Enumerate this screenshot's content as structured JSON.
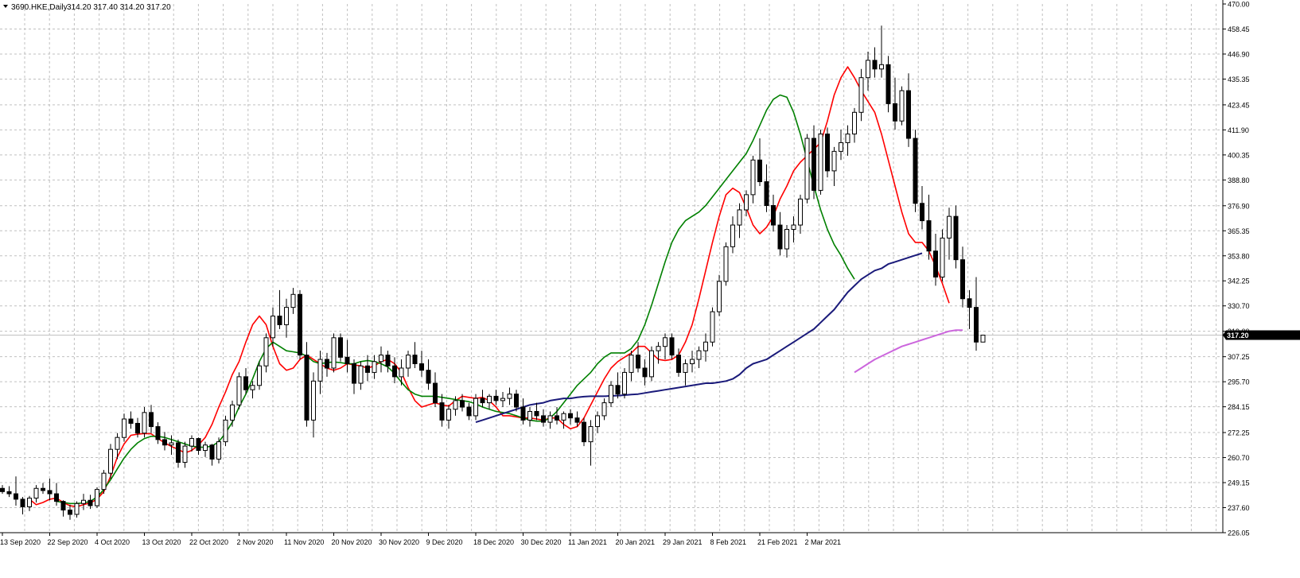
{
  "header": {
    "symbol": "3690.HKE,Daily",
    "ohlc": "314.20 317.40 314.20 317.20"
  },
  "colors": {
    "background": "#ffffff",
    "grid": "#c0c0c0",
    "axis": "#000000",
    "bull_fill": "#ffffff",
    "bear_fill": "#000000",
    "candle_outline": "#000000",
    "price_line": "#c0c0c0",
    "price_label_bg": "#000000",
    "price_label_text": "#ffffff"
  },
  "chart_data": {
    "type": "candlestick",
    "title": "3690.HKE,Daily",
    "ylim": [
      226.05,
      470.0
    ],
    "y_ticks": [
      "470.00",
      "458.45",
      "446.90",
      "435.35",
      "423.45",
      "411.90",
      "400.35",
      "388.80",
      "376.90",
      "365.35",
      "353.80",
      "342.25",
      "330.70",
      "319.00",
      "307.25",
      "295.70",
      "284.15",
      "272.25",
      "260.70",
      "249.15",
      "237.60",
      "226.05"
    ],
    "x_labels": [
      {
        "label": "13 Sep 2020",
        "index": 0
      },
      {
        "label": "22 Sep 2020",
        "index": 7
      },
      {
        "label": "4 Oct 2020",
        "index": 14
      },
      {
        "label": "13 Oct 2020",
        "index": 21
      },
      {
        "label": "22 Oct 2020",
        "index": 28
      },
      {
        "label": "2 Nov 2020",
        "index": 35
      },
      {
        "label": "11 Nov 2020",
        "index": 42
      },
      {
        "label": "20 Nov 2020",
        "index": 49
      },
      {
        "label": "30 Nov 2020",
        "index": 56
      },
      {
        "label": "9 Dec 2020",
        "index": 63
      },
      {
        "label": "18 Dec 2020",
        "index": 70
      },
      {
        "label": "30 Dec 2020",
        "index": 77
      },
      {
        "label": "11 Jan 2021",
        "index": 84
      },
      {
        "label": "20 Jan 2021",
        "index": 91
      },
      {
        "label": "29 Jan 2021",
        "index": 98
      },
      {
        "label": "8 Feb 2021",
        "index": 105
      },
      {
        "label": "21 Feb 2021",
        "index": 112
      },
      {
        "label": "2 Mar 2021",
        "index": 119
      }
    ],
    "candles": [
      [
        246.5,
        248.0,
        244.0,
        245.0
      ],
      [
        245.0,
        247.5,
        242.5,
        244.0
      ],
      [
        244.0,
        252.0,
        238.5,
        241.5
      ],
      [
        241.5,
        242.5,
        234.5,
        238.0
      ],
      [
        238.0,
        243.0,
        236.0,
        242.0
      ],
      [
        242.0,
        248.0,
        240.0,
        246.5
      ],
      [
        246.5,
        249.0,
        244.0,
        245.5
      ],
      [
        245.5,
        251.0,
        241.0,
        244.0
      ],
      [
        244.0,
        249.0,
        238.5,
        240.5
      ],
      [
        240.5,
        241.0,
        233.5,
        236.5
      ],
      [
        236.5,
        239.0,
        232.0,
        234.5
      ],
      [
        234.5,
        240.5,
        233.0,
        239.5
      ],
      [
        239.5,
        244.0,
        236.5,
        241.0
      ],
      [
        241.0,
        243.5,
        237.0,
        238.5
      ],
      [
        238.5,
        247.0,
        237.5,
        246.0
      ],
      [
        246.0,
        255.0,
        244.0,
        253.5
      ],
      [
        253.5,
        267.0,
        251.0,
        264.5
      ],
      [
        264.5,
        272.0,
        260.0,
        270.0
      ],
      [
        270.0,
        281.0,
        268.0,
        278.5
      ],
      [
        278.5,
        282.0,
        274.0,
        276.5
      ],
      [
        276.5,
        279.0,
        270.0,
        272.0
      ],
      [
        272.0,
        284.0,
        270.0,
        281.5
      ],
      [
        281.5,
        285.0,
        272.0,
        275.0
      ],
      [
        275.0,
        277.0,
        267.0,
        269.0
      ],
      [
        269.0,
        272.5,
        264.0,
        266.5
      ],
      [
        266.5,
        271.0,
        262.0,
        267.5
      ],
      [
        267.5,
        269.0,
        256.0,
        258.5
      ],
      [
        258.5,
        268.0,
        256.0,
        266.0
      ],
      [
        266.0,
        271.0,
        263.5,
        269.5
      ],
      [
        269.5,
        270.0,
        262.0,
        264.0
      ],
      [
        264.0,
        268.0,
        261.0,
        266.5
      ],
      [
        266.5,
        267.0,
        257.0,
        260.0
      ],
      [
        260.0,
        270.0,
        258.0,
        268.0
      ],
      [
        268.0,
        280.0,
        266.0,
        278.0
      ],
      [
        278.0,
        287.0,
        275.0,
        285.0
      ],
      [
        285.0,
        300.0,
        283.0,
        298.0
      ],
      [
        298.0,
        302.0,
        290.0,
        292.0
      ],
      [
        292.0,
        296.0,
        288.0,
        294.0
      ],
      [
        294.0,
        305.0,
        292.0,
        303.0
      ],
      [
        303.0,
        318.0,
        300.0,
        316.0
      ],
      [
        316.0,
        330.0,
        312.0,
        326.0
      ],
      [
        326.0,
        338.0,
        320.0,
        322.0
      ],
      [
        322.0,
        334.0,
        316.0,
        330.0
      ],
      [
        330.0,
        339.0,
        327.0,
        336.0
      ],
      [
        336.0,
        338.0,
        306.0,
        308.0
      ],
      [
        308.0,
        314.0,
        275.0,
        278.0
      ],
      [
        278.0,
        300.0,
        270.0,
        296.0
      ],
      [
        296.0,
        310.0,
        290.0,
        306.0
      ],
      [
        306.0,
        309.0,
        298.0,
        302.0
      ],
      [
        302.0,
        318.0,
        300.0,
        316.0
      ],
      [
        316.0,
        318.0,
        305.0,
        307.0
      ],
      [
        307.0,
        315.0,
        300.0,
        304.0
      ],
      [
        304.0,
        306.0,
        290.0,
        295.0
      ],
      [
        295.0,
        305.0,
        292.0,
        303.0
      ],
      [
        303.0,
        308.0,
        296.0,
        300.0
      ],
      [
        300.0,
        308.0,
        297.0,
        305.0
      ],
      [
        305.0,
        312.0,
        300.0,
        308.0
      ],
      [
        308.0,
        310.0,
        300.0,
        303.0
      ],
      [
        303.0,
        307.0,
        295.0,
        298.0
      ],
      [
        298.0,
        306.0,
        294.0,
        302.0
      ],
      [
        302.0,
        310.0,
        298.0,
        308.0
      ],
      [
        308.0,
        314.0,
        302.0,
        304.0
      ],
      [
        304.0,
        310.0,
        298.0,
        301.0
      ],
      [
        301.0,
        306.0,
        292.0,
        295.0
      ],
      [
        295.0,
        300.0,
        284.0,
        286.0
      ],
      [
        286.0,
        290.0,
        275.0,
        278.0
      ],
      [
        278.0,
        285.0,
        274.0,
        283.0
      ],
      [
        283.0,
        289.0,
        280.0,
        287.0
      ],
      [
        287.0,
        290.0,
        282.0,
        284.0
      ],
      [
        284.0,
        286.0,
        278.0,
        280.0
      ],
      [
        280.0,
        290.0,
        278.0,
        288.0
      ],
      [
        288.0,
        292.0,
        284.0,
        286.0
      ],
      [
        286.0,
        290.0,
        283.0,
        289.0
      ],
      [
        289.0,
        292.0,
        285.0,
        287.0
      ],
      [
        287.0,
        291.0,
        284.0,
        288.0
      ],
      [
        288.0,
        293.0,
        285.0,
        290.0
      ],
      [
        290.0,
        292.0,
        282.0,
        284.0
      ],
      [
        284.0,
        288.0,
        276.0,
        278.0
      ],
      [
        278.0,
        284.0,
        275.0,
        282.0
      ],
      [
        282.0,
        286.0,
        278.0,
        280.0
      ],
      [
        280.0,
        283.0,
        275.0,
        277.0
      ],
      [
        277.0,
        282.0,
        274.0,
        280.0
      ],
      [
        280.0,
        284.0,
        276.0,
        278.0
      ],
      [
        278.0,
        282.0,
        274.0,
        281.0
      ],
      [
        281.0,
        283.0,
        276.0,
        279.0
      ],
      [
        279.0,
        282.0,
        275.0,
        277.0
      ],
      [
        277.0,
        279.0,
        266.0,
        268.0
      ],
      [
        268.0,
        278.0,
        257.0,
        275.0
      ],
      [
        275.0,
        282.0,
        272.0,
        280.0
      ],
      [
        280.0,
        288.0,
        278.0,
        286.0
      ],
      [
        286.0,
        296.0,
        284.0,
        294.0
      ],
      [
        294.0,
        300.0,
        288.0,
        290.0
      ],
      [
        290.0,
        302.0,
        288.0,
        300.0
      ],
      [
        300.0,
        310.0,
        296.0,
        308.0
      ],
      [
        308.0,
        314.0,
        300.0,
        302.0
      ],
      [
        302.0,
        306.0,
        294.0,
        298.0
      ],
      [
        298.0,
        312.0,
        296.0,
        310.0
      ],
      [
        310.0,
        314.0,
        304.0,
        312.0
      ],
      [
        312.0,
        318.0,
        306.0,
        316.0
      ],
      [
        316.0,
        318.0,
        306.0,
        308.0
      ],
      [
        308.0,
        311.0,
        298.0,
        300.0
      ],
      [
        300.0,
        306.0,
        294.0,
        304.0
      ],
      [
        304.0,
        310.0,
        300.0,
        306.0
      ],
      [
        306.0,
        312.0,
        302.0,
        310.0
      ],
      [
        310.0,
        318.0,
        305.0,
        314.0
      ],
      [
        314.0,
        330.0,
        312.0,
        328.0
      ],
      [
        328.0,
        345.0,
        326.0,
        342.0
      ],
      [
        342.0,
        360.0,
        340.0,
        358.0
      ],
      [
        358.0,
        372.0,
        355.0,
        368.0
      ],
      [
        368.0,
        378.0,
        362.0,
        375.0
      ],
      [
        375.0,
        384.0,
        372.0,
        382.0
      ],
      [
        382.0,
        400.0,
        378.0,
        398.0
      ],
      [
        398.0,
        408.0,
        386.0,
        388.0
      ],
      [
        388.0,
        396.0,
        374.0,
        377.0
      ],
      [
        377.0,
        382.0,
        365.0,
        368.0
      ],
      [
        368.0,
        374.0,
        354.0,
        357.0
      ],
      [
        357.0,
        368.0,
        353.0,
        366.0
      ],
      [
        366.0,
        372.0,
        360.0,
        368.0
      ],
      [
        368.0,
        382.0,
        364.0,
        380.0
      ],
      [
        380.0,
        410.0,
        378.0,
        408.0
      ],
      [
        408.0,
        414.0,
        380.0,
        384.0
      ],
      [
        384.0,
        412.0,
        382.0,
        410.0
      ],
      [
        410.0,
        413.0,
        390.0,
        393.0
      ],
      [
        393.0,
        404.0,
        386.0,
        402.0
      ],
      [
        402.0,
        412.0,
        398.0,
        406.0
      ],
      [
        406.0,
        414.0,
        400.0,
        410.0
      ],
      [
        410.0,
        422.0,
        406.0,
        420.0
      ],
      [
        420.0,
        440.0,
        416.0,
        436.0
      ],
      [
        436.0,
        448.0,
        430.0,
        444.0
      ],
      [
        444.0,
        450.0,
        436.0,
        440.0
      ],
      [
        440.0,
        460.0,
        436.0,
        442.0
      ],
      [
        442.0,
        446.0,
        420.0,
        424.0
      ],
      [
        424.0,
        436.0,
        412.0,
        416.0
      ],
      [
        416.0,
        432.0,
        414.0,
        430.0
      ],
      [
        430.0,
        438.0,
        404.0,
        408.0
      ],
      [
        408.0,
        412.0,
        374.0,
        378.0
      ],
      [
        378.0,
        386.0,
        366.0,
        370.0
      ],
      [
        370.0,
        382.0,
        352.0,
        356.0
      ],
      [
        356.0,
        364.0,
        340.0,
        344.0
      ],
      [
        344.0,
        366.0,
        342.0,
        362.0
      ],
      [
        362.0,
        376.0,
        352.0,
        372.0
      ],
      [
        372.0,
        377.0,
        348.0,
        352.0
      ],
      [
        352.0,
        358.0,
        330.0,
        334.0
      ],
      [
        334.0,
        338.0,
        320.0,
        330.0
      ],
      [
        330.0,
        344.0,
        310.0,
        314.0
      ],
      [
        314.0,
        317.4,
        314.2,
        317.2
      ]
    ],
    "series": [
      {
        "color": "#ff0000",
        "width": 1.6,
        "start": 4,
        "values": [
          241.5,
          239.0,
          240.0,
          241.5,
          242.0,
          240.0,
          238.5,
          238.0,
          239.0,
          239.8,
          241.5,
          245.0,
          252.0,
          261.0,
          267.0,
          271.0,
          271.5,
          271.8,
          271.7,
          269.5,
          267.5,
          265.8,
          264.5,
          262.8,
          264.0,
          266.5,
          270.0,
          276.0,
          284.0,
          291.0,
          299.0,
          305.0,
          314.0,
          322.0,
          326.0,
          322.0,
          312.0,
          304.0,
          301.0,
          302.0,
          306.0,
          308.0,
          306.0,
          304.0,
          302.0,
          301.0,
          302.0,
          304.0,
          303.5,
          303.0,
          302.0,
          303.0,
          305.0,
          306.0,
          304.0,
          300.0,
          293.0,
          287.0,
          284.0,
          285.0,
          286.0,
          285.0,
          284.5,
          287.0,
          289.0,
          288.5,
          288.0,
          288.5,
          287.0,
          284.0,
          280.0,
          280.0,
          279.5,
          279.0,
          279.0,
          278.5,
          278.0,
          279.0,
          279.0,
          276.0,
          274.0,
          275.0,
          279.0,
          285.0,
          291.0,
          297.0,
          302.0,
          305.0,
          307.0,
          309.0,
          312.0,
          312.0,
          309.0,
          306.0,
          305.5,
          306.0,
          308.0,
          314.0,
          322.0,
          334.0,
          347.0,
          360.0,
          372.0,
          382.0,
          385.0,
          383.0,
          376.0,
          368.0,
          364.0,
          367.0,
          372.0,
          380.0,
          386.0,
          393.0,
          397.0,
          400.0,
          403.0,
          406.0,
          416.0,
          428.0,
          436.0,
          441.0,
          436.0,
          430.0,
          425.0,
          420.0,
          410.0,
          398.0,
          386.0,
          374.0,
          364.0,
          360.0,
          360.0,
          356.0,
          349.0,
          341.0,
          332.0
        ]
      },
      {
        "color": "#008000",
        "width": 1.6,
        "start": 8,
        "values": [
          240.5,
          240.0,
          239.5,
          239.5,
          239.8,
          240.5,
          242.5,
          246.0,
          250.5,
          255.5,
          260.5,
          264.5,
          267.5,
          269.5,
          270.5,
          270.5,
          270.0,
          269.0,
          268.0,
          267.0,
          266.0,
          265.5,
          265.5,
          266.0,
          268.0,
          272.0,
          277.0,
          284.0,
          290.0,
          297.0,
          305.0,
          311.0,
          314.0,
          312.0,
          310.0,
          309.5,
          309.0,
          307.5,
          305.0,
          304.0,
          304.5,
          304.8,
          304.5,
          304.0,
          304.0,
          305.0,
          305.5,
          305.0,
          304.0,
          302.5,
          299.5,
          295.5,
          292.0,
          290.0,
          289.0,
          289.0,
          289.0,
          288.5,
          288.0,
          287.5,
          287.0,
          286.5,
          285.5,
          284.0,
          283.0,
          282.0,
          281.5,
          281.0,
          280.0,
          279.0,
          278.0,
          277.5,
          277.5,
          279.0,
          282.0,
          286.0,
          290.0,
          294.0,
          297.0,
          300.0,
          304.0,
          307.0,
          309.0,
          309.0,
          309.0,
          311.0,
          315.0,
          322.0,
          331.0,
          341.0,
          351.0,
          360.0,
          366.0,
          370.0,
          372.0,
          374.0,
          377.0,
          381.0,
          385.0,
          389.0,
          393.0,
          397.0,
          401.0,
          407.0,
          414.0,
          421.0,
          426.0,
          428.0,
          427.0,
          420.0,
          410.0,
          398.0,
          386.0,
          375.0,
          366.0,
          359.0,
          354.0,
          348.0,
          343.0
        ]
      },
      {
        "color": "#1a1a7a",
        "width": 2,
        "start": 70,
        "values": [
          277.0,
          278.0,
          279.0,
          280.0,
          281.0,
          282.0,
          283.0,
          284.0,
          285.0,
          285.5,
          286.0,
          287.0,
          287.5,
          288.0,
          288.0,
          288.5,
          288.8,
          289.0,
          289.0,
          289.0,
          289.2,
          289.3,
          289.5,
          289.8,
          290.0,
          290.5,
          291.0,
          291.5,
          292.0,
          292.5,
          293.0,
          293.5,
          294.0,
          294.5,
          295.0,
          295.0,
          295.5,
          296.0,
          297.0,
          299.0,
          302.0,
          304.0,
          305.0,
          306.0,
          308.0,
          310.0,
          312.0,
          314.0,
          316.0,
          318.0,
          320.0,
          323.0,
          326.0,
          329.0,
          333.0,
          337.0,
          340.0,
          343.0,
          345.0,
          347.0,
          348.0,
          350.0,
          351.0,
          352.0,
          353.0,
          354.0,
          355.0
        ]
      },
      {
        "color": "#cc66dd",
        "width": 2,
        "start": 126,
        "values": [
          300.0,
          302.0,
          304.0,
          306.0,
          307.5,
          309.0,
          310.5,
          312.0,
          313.0,
          314.0,
          315.0,
          316.0,
          317.0,
          318.0,
          319.0,
          319.5,
          319.5
        ]
      }
    ],
    "last_price": "317.20",
    "last_price_value": 317.2
  }
}
